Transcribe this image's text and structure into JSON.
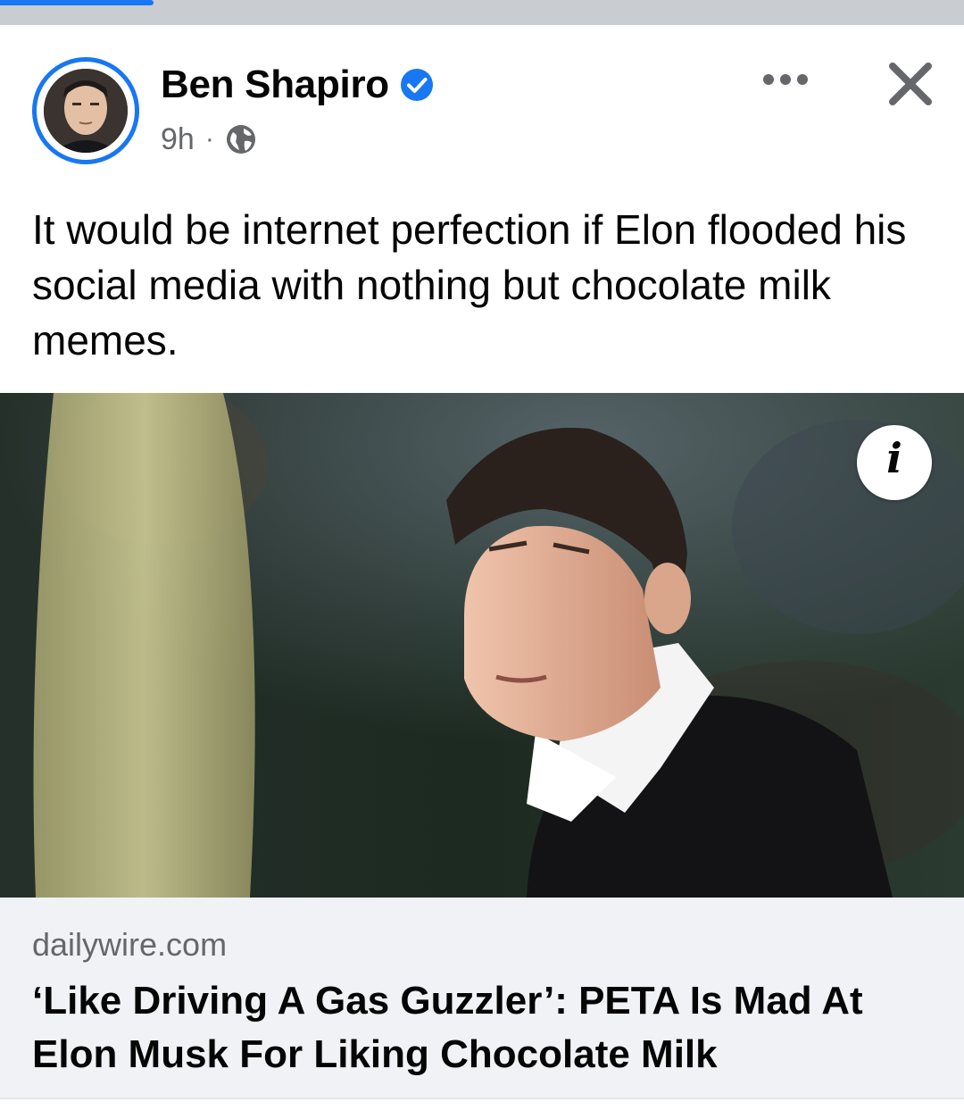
{
  "post": {
    "author": "Ben Shapiro",
    "time": "9h",
    "separator": "·",
    "audience_icon": "globe-icon",
    "verified_icon": "verified-badge-icon",
    "text": "It would be internet perfection if Elon flooded his social media with nothing but chocolate milk memes."
  },
  "header": {
    "more_icon": "more-options-icon",
    "close_icon": "close-icon"
  },
  "link": {
    "domain": "dailywire.com",
    "title": "‘Like Driving A Gas Guzzler’: PETA Is Mad At Elon Musk For Liking Chocolate Milk",
    "info_label": "i"
  },
  "colors": {
    "accent": "#1877f2",
    "text_primary": "#050505",
    "text_secondary": "#65676b",
    "link_box_bg": "#f0f2f5"
  }
}
